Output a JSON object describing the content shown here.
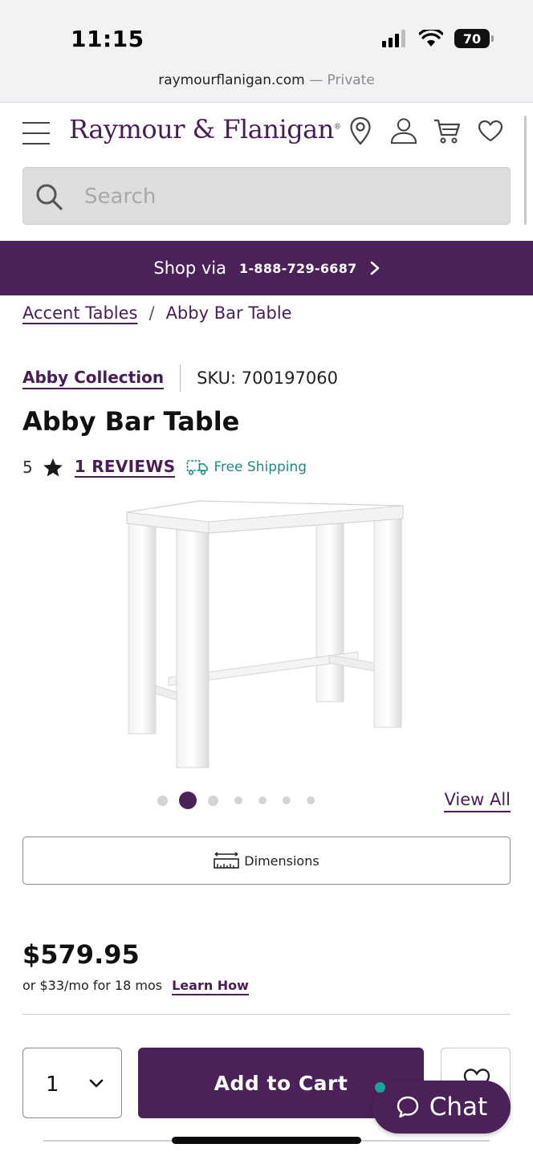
{
  "status_bar": {
    "time": "11:15",
    "battery": "70"
  },
  "browser": {
    "domain": "raymourflanigan.com",
    "mode": " — Private"
  },
  "header": {
    "logo": "Raymour & Flanigan",
    "logo_mark": "®",
    "icons": [
      "location-pin-icon",
      "account-icon",
      "cart-icon",
      "heart-icon"
    ]
  },
  "search": {
    "placeholder": "Search",
    "value": ""
  },
  "promo": {
    "text": "Shop via",
    "phone": "1-888-729-6687"
  },
  "breadcrumb": {
    "parent": "Accent Tables",
    "separator": "/",
    "current": "Abby Bar Table"
  },
  "product": {
    "collection": "Abby Collection",
    "sku": "SKU: 700197060",
    "title": "Abby Bar Table",
    "rating": "5",
    "reviews": "1 REVIEWS",
    "shipping": "Free Shipping",
    "image_count": 7,
    "active_image": 2,
    "view_all": "View All",
    "dimensions_label": "Dimensions",
    "price": "$579.95",
    "finance_text": "or $33/mo for 18 mos",
    "learn_how": "Learn How"
  },
  "actions": {
    "quantity": "1",
    "add_to_cart": "Add to Cart",
    "chat": "Chat"
  },
  "colors": {
    "brand_purple": "#4b2159",
    "shipping_teal": "#1e8a84",
    "chat_status": "#19a39c"
  }
}
